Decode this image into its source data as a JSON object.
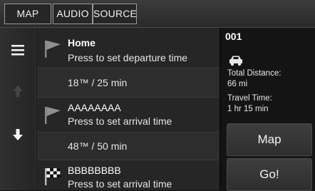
{
  "tabs": [
    {
      "label": "MAP"
    },
    {
      "label": "AUDIO"
    },
    {
      "label": "SOURCE"
    }
  ],
  "destinations": [
    {
      "name": "Home",
      "subtitle": "Press to set departure time",
      "icon": "flag-icon"
    },
    {
      "name": "AAAAAAAA",
      "subtitle": "Press to set arrival time",
      "icon": "flag-icon",
      "leg": "48™ / 50 min"
    },
    {
      "name": "BBBBBBBB",
      "subtitle": "Press to set arrival time",
      "icon": "checkered-flag-icon"
    }
  ],
  "legs": [
    {
      "text": "18™ / 25 min"
    },
    {
      "text": "48™ / 50 min"
    }
  ],
  "trip": {
    "id": "001",
    "vehicle_icon": "car-icon",
    "total_distance_label": "Total Distance:",
    "total_distance_value": "66 mi",
    "travel_time_label": "Travel Time:",
    "travel_time_value": "1 hr 15 min"
  },
  "buttons": {
    "map": "Map",
    "go": "Go!"
  },
  "sidebar": {
    "menu_icon": "menu-icon",
    "up_icon": "arrow-up-icon",
    "down_icon": "arrow-down-icon"
  }
}
